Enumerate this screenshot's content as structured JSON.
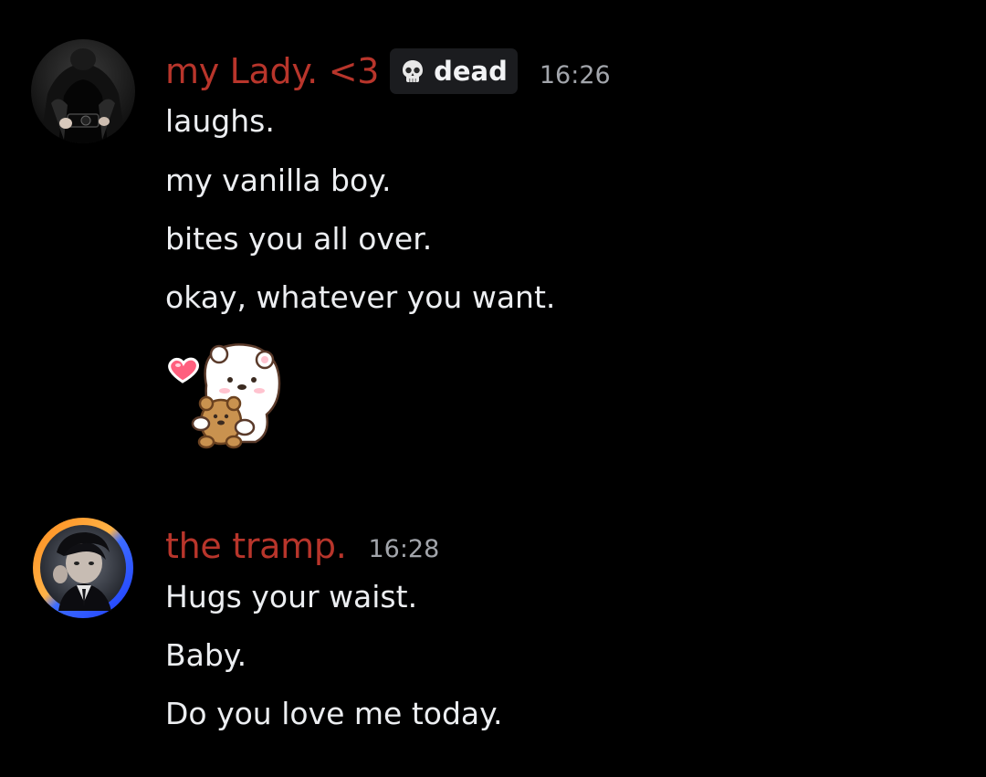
{
  "messages": [
    {
      "author": "my Lady. <3",
      "tag": {
        "icon": "skull-icon",
        "label": "dead"
      },
      "timestamp": "16:26",
      "lines": [
        "laughs.",
        "my vanilla boy.",
        "bites you all over.",
        "okay, whatever you want."
      ],
      "sticker": "bear-hug-heart-sticker"
    },
    {
      "author": "the tramp.",
      "timestamp": "16:28",
      "lines": [
        "Hugs your waist.",
        "Baby.",
        "Do you love me today."
      ]
    }
  ],
  "colors": {
    "background": "#000000",
    "username": "#b8352b",
    "message_text": "#eceef1",
    "timestamp": "#a2a5ab",
    "tag_background": "#1b1c1f"
  }
}
